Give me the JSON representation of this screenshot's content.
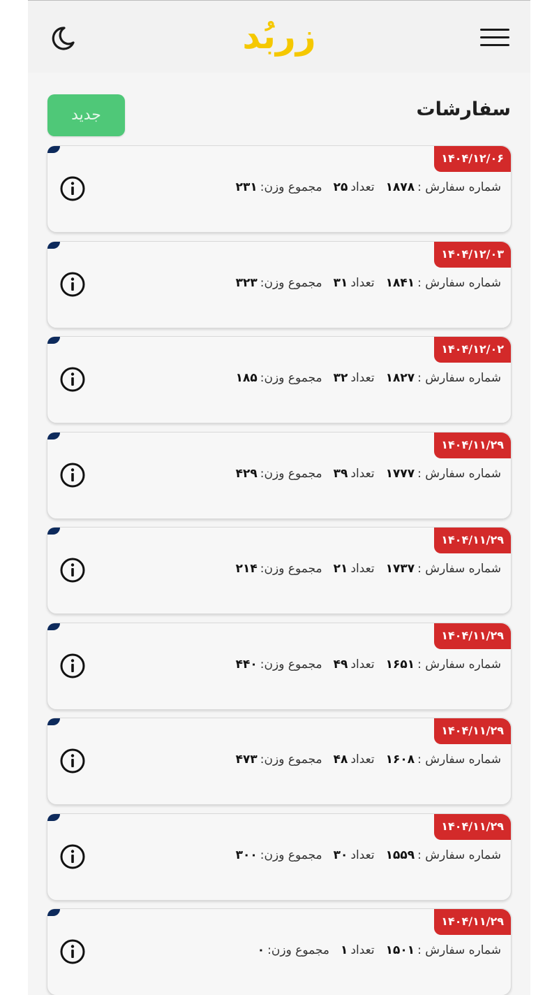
{
  "header": {
    "logo_text": "زربُد",
    "theme_icon": "moon-icon",
    "menu_icon": "hamburger-icon"
  },
  "page": {
    "title": "سفارشات",
    "new_button_label": "جدید"
  },
  "labels": {
    "order_number": "شماره سفارش :",
    "count": "تعداد",
    "total_weight": "مجموع وزن:"
  },
  "colors": {
    "accent_green": "#4fc878",
    "date_red": "#d32a2a",
    "logo_yellow": "#f5c800",
    "corner_navy": "#0d2a5c"
  },
  "orders": [
    {
      "date": "۱۴۰۴/۱۲/۰۶",
      "order_number": "۱۸۷۸",
      "count": "۲۵",
      "weight": "۲۳۱"
    },
    {
      "date": "۱۴۰۴/۱۲/۰۳",
      "order_number": "۱۸۴۱",
      "count": "۳۱",
      "weight": "۳۲۳"
    },
    {
      "date": "۱۴۰۴/۱۲/۰۲",
      "order_number": "۱۸۲۷",
      "count": "۳۲",
      "weight": "۱۸۵"
    },
    {
      "date": "۱۴۰۴/۱۱/۲۹",
      "order_number": "۱۷۷۷",
      "count": "۳۹",
      "weight": "۴۲۹"
    },
    {
      "date": "۱۴۰۴/۱۱/۲۹",
      "order_number": "۱۷۳۷",
      "count": "۲۱",
      "weight": "۲۱۴"
    },
    {
      "date": "۱۴۰۴/۱۱/۲۹",
      "order_number": "۱۶۵۱",
      "count": "۴۹",
      "weight": "۴۴۰"
    },
    {
      "date": "۱۴۰۴/۱۱/۲۹",
      "order_number": "۱۶۰۸",
      "count": "۴۸",
      "weight": "۴۷۳"
    },
    {
      "date": "۱۴۰۴/۱۱/۲۹",
      "order_number": "۱۵۵۹",
      "count": "۳۰",
      "weight": "۳۰۰"
    },
    {
      "date": "۱۴۰۴/۱۱/۲۹",
      "order_number": "۱۵۰۱",
      "count": "۱",
      "weight": "۰"
    }
  ]
}
